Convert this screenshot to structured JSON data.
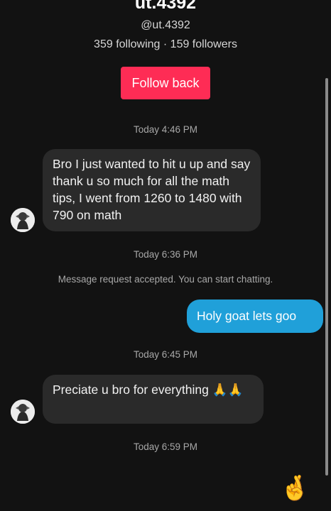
{
  "profile": {
    "name": "ut.4392",
    "handle": "@ut.4392",
    "stats": "359 following · 159 followers",
    "follow_back_label": "Follow back"
  },
  "timestamps": [
    "Today 4:46 PM",
    "Today 6:36 PM",
    "Today 6:45 PM",
    "Today 6:59 PM"
  ],
  "system_message": "Message request accepted. You can start chatting.",
  "messages": [
    {
      "direction": "incoming",
      "text": "Bro I just wanted to hit u up and say thank u so much for all the math tips, I went from 1260 to 1480 with 790 on math"
    },
    {
      "direction": "outgoing",
      "text": "Holy goat lets goo"
    },
    {
      "direction": "incoming",
      "text": "Preciate u bro for everything 🙏🙏"
    }
  ],
  "last_sent_emoji": "🤞",
  "colors": {
    "background": "#121212",
    "accent_follow": "#fe2c55",
    "outgoing_bubble": "#20a0d9",
    "incoming_bubble": "#2a2a2a"
  },
  "icons": [
    "avatar-icon",
    "folded-hands-emoji",
    "crossed-fingers-emoji"
  ]
}
